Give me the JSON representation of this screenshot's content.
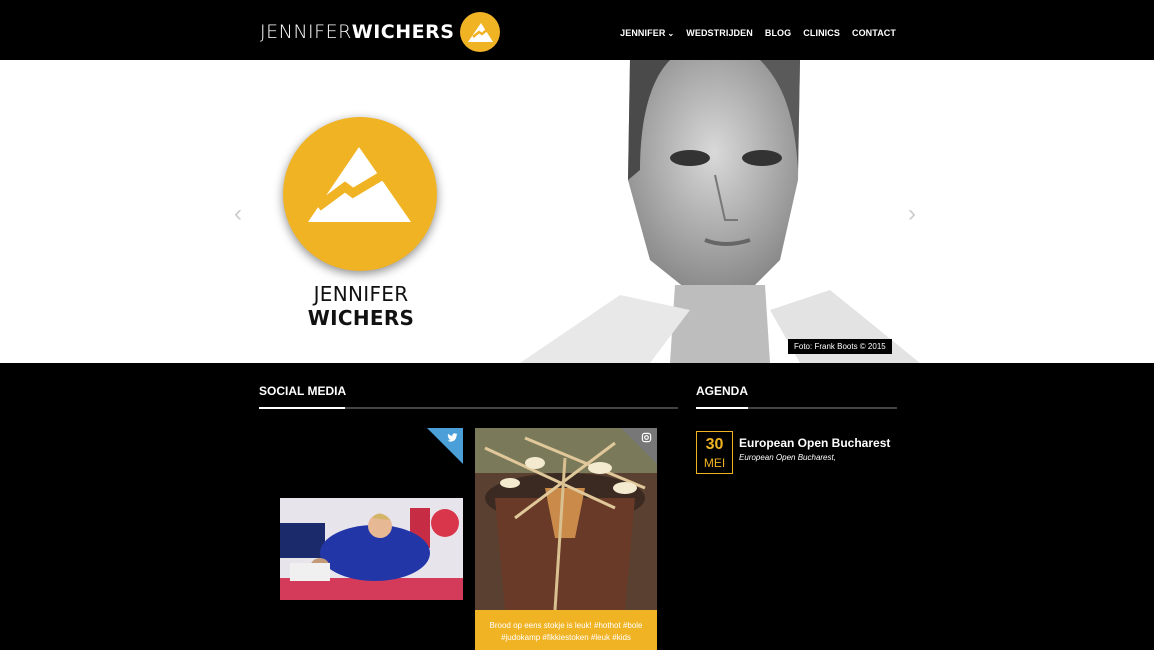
{
  "header": {
    "logo_first": "JENNIFER",
    "logo_last": "WICHERS",
    "nav": [
      {
        "label": "JENNIFER",
        "has_dropdown": true
      },
      {
        "label": "WEDSTRIJDEN"
      },
      {
        "label": "BLOG"
      },
      {
        "label": "CLINICS"
      },
      {
        "label": "CONTACT"
      }
    ]
  },
  "hero": {
    "name_first": "JENNIFER",
    "name_last": "WICHERS",
    "photo_credit": "Foto: Frank Boots © 2015"
  },
  "social": {
    "title": "SOCIAL MEDIA",
    "instagram_caption": "Brood op eens stokje is leuk! #hothot #bole #judokamp #fikkiestoken #leuk #kids"
  },
  "agenda": {
    "title": "AGENDA",
    "items": [
      {
        "day": "30",
        "month": "MEI",
        "title": "European Open Bucharest",
        "subtitle": "European Open Bucharest,"
      }
    ]
  },
  "colors": {
    "accent": "#f0b323",
    "twitter": "#4a9fd8",
    "background": "#000000"
  }
}
